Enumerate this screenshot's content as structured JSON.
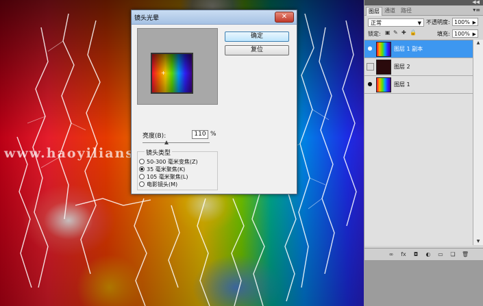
{
  "watermark": "www.haoyiliansl.com",
  "dialog": {
    "title": "镜头光晕",
    "ok_label": "确定",
    "reset_label": "复位",
    "brightness_label": "亮度(B):",
    "brightness_value": "110",
    "brightness_unit": "%",
    "brightness_level": 110,
    "lens_group_label": "镜头类型",
    "lens_options": [
      {
        "label": "50-300 毫米变焦(Z)",
        "selected": false
      },
      {
        "label": "35 毫米聚焦(K)",
        "selected": true
      },
      {
        "label": "105 毫米聚焦(L)",
        "selected": false
      },
      {
        "label": "电影镜头(M)",
        "selected": false
      }
    ]
  },
  "panel": {
    "tabs": [
      "图层",
      "通道",
      "路径"
    ],
    "active_tab": 0,
    "blend_mode": "正常",
    "opacity_label": "不透明度:",
    "opacity_value": "100%",
    "lock_label": "锁定:",
    "fill_label": "填充:",
    "fill_value": "100%",
    "layers": [
      {
        "name": "图层 1 副本",
        "visible": true,
        "selected": true,
        "thumb": "color"
      },
      {
        "name": "图层 2",
        "visible": false,
        "selected": false,
        "thumb": "dark"
      },
      {
        "name": "图层 1",
        "visible": true,
        "selected": false,
        "thumb": "color"
      }
    ]
  },
  "icons": {
    "dialog_close": "close-icon",
    "panel_menu": "panel-menu-icon",
    "eye": "eye-icon"
  }
}
